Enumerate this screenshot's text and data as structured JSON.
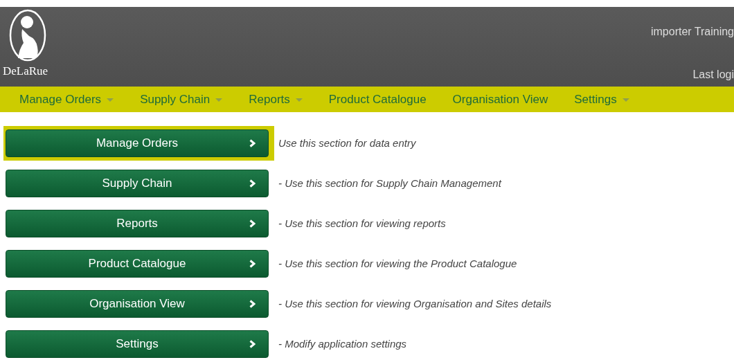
{
  "header": {
    "logo_text": "DeLaRue",
    "user": "importer Training",
    "last_login": "Last logi"
  },
  "menu": [
    {
      "label": "Manage Orders",
      "has_dropdown": true
    },
    {
      "label": "Supply Chain",
      "has_dropdown": true
    },
    {
      "label": "Reports",
      "has_dropdown": true
    },
    {
      "label": "Product Catalogue",
      "has_dropdown": false
    },
    {
      "label": "Organisation View",
      "has_dropdown": false
    },
    {
      "label": "Settings",
      "has_dropdown": true
    }
  ],
  "sections": [
    {
      "label": "Manage Orders",
      "description": "Use this section for data entry",
      "selected": true
    },
    {
      "label": "Supply Chain",
      "description": "- Use this section for Supply Chain Management",
      "selected": false
    },
    {
      "label": "Reports",
      "description": "- Use this section for viewing reports",
      "selected": false
    },
    {
      "label": "Product Catalogue",
      "description": "- Use this section for viewing the Product Catalogue",
      "selected": false
    },
    {
      "label": "Organisation View",
      "description": "- Use this section for viewing Organisation and Sites details",
      "selected": false
    },
    {
      "label": "Settings",
      "description": "- Modify application settings",
      "selected": false
    }
  ]
}
